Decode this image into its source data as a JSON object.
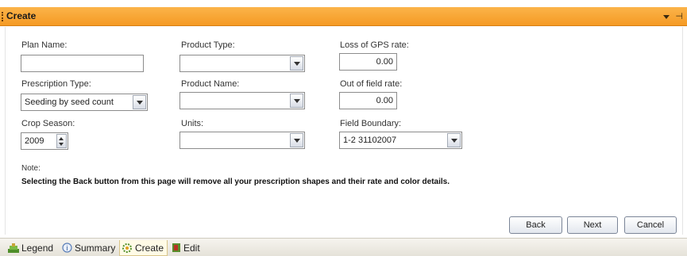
{
  "window": {
    "title": "Create",
    "pin_glyph": "⊣"
  },
  "form": {
    "plan_name": {
      "label": "Plan Name:",
      "value": ""
    },
    "prescription_type": {
      "label": "Prescription Type:",
      "value": "Seeding by seed count"
    },
    "crop_season": {
      "label": "Crop Season:",
      "value": "2009"
    },
    "product_type": {
      "label": "Product Type:",
      "value": ""
    },
    "product_name": {
      "label": "Product Name:",
      "value": ""
    },
    "units": {
      "label": "Units:",
      "value": ""
    },
    "loss_of_gps_rate": {
      "label": "Loss of GPS rate:",
      "value": "0.00"
    },
    "out_of_field_rate": {
      "label": "Out of field rate:",
      "value": "0.00"
    },
    "field_boundary": {
      "label": "Field Boundary:",
      "value": "1-2 31102007"
    }
  },
  "note": {
    "label": "Note:",
    "text": "Selecting the Back button from this page will remove all your prescription shapes and their rate and color details."
  },
  "buttons": {
    "back": "Back",
    "next": "Next",
    "cancel": "Cancel"
  },
  "tabs": [
    {
      "label": "Legend",
      "icon": "legend-icon"
    },
    {
      "label": "Summary",
      "icon": "summary-icon"
    },
    {
      "label": "Create",
      "icon": "create-icon",
      "active": true
    },
    {
      "label": "Edit",
      "icon": "edit-icon"
    }
  ],
  "colors": {
    "titlebar_accent": "#f59a24",
    "active_tab": "#fffbe6"
  }
}
